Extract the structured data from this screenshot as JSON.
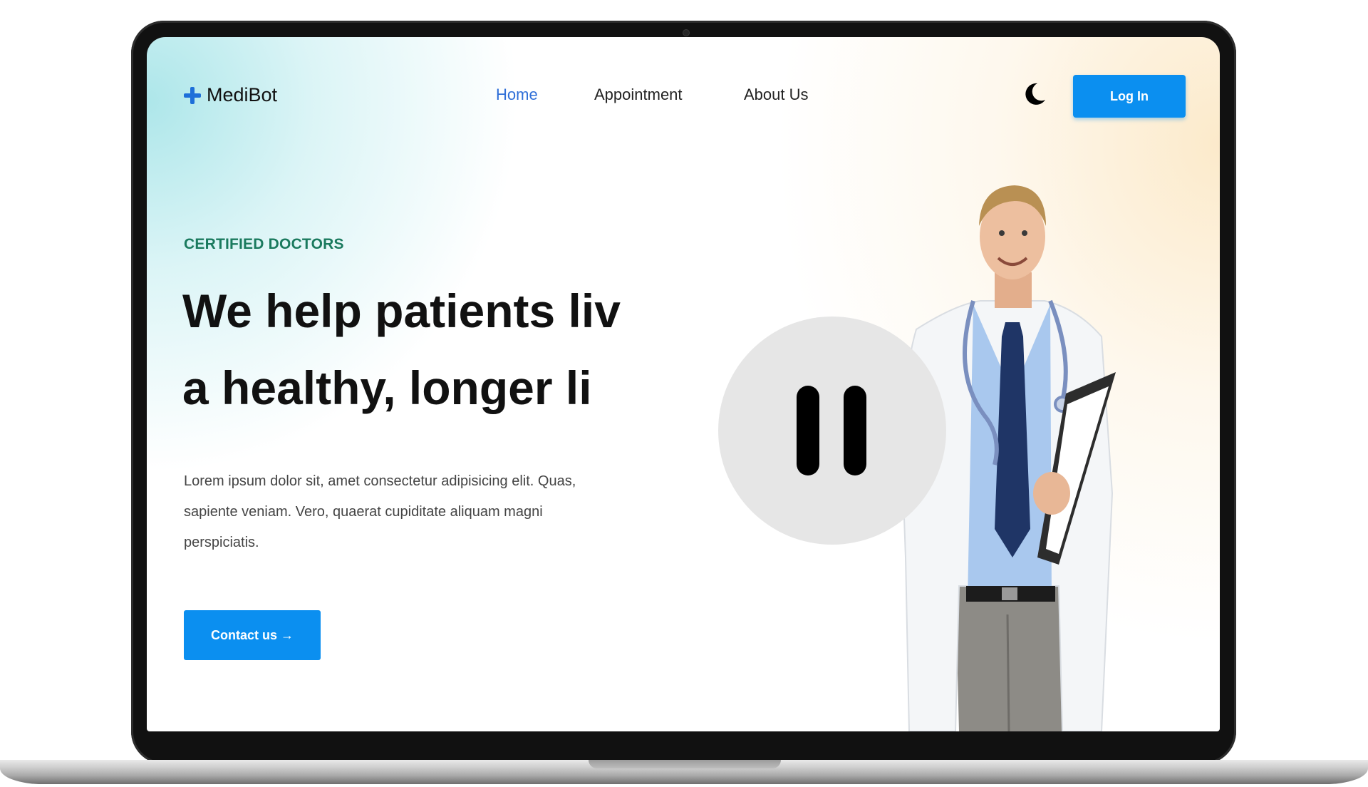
{
  "brand": {
    "name": "MediBot",
    "logo_icon": "plus-icon",
    "accent_color": "#1e6fd9"
  },
  "nav": {
    "items": [
      {
        "label": "Home",
        "active": true
      },
      {
        "label": "Appointment",
        "active": false
      },
      {
        "label": "About Us",
        "active": false
      }
    ],
    "theme_toggle_icon": "moon-icon",
    "login_label": "Log In"
  },
  "hero": {
    "eyebrow": "CERTIFIED DOCTORS",
    "headline_line1": "We help patients liv",
    "headline_line2": "a healthy, longer li",
    "lead": "Lorem ipsum dolor sit, amet consectetur adipisicing elit. Quas, sapiente veniam. Vero, quaerat cupiditate aliquam magni perspiciatis.",
    "cta_label": "Contact us →",
    "primary_color": "#0b8ff0",
    "eyebrow_color": "#1a7a5e"
  },
  "overlay": {
    "icon": "pause-icon"
  }
}
